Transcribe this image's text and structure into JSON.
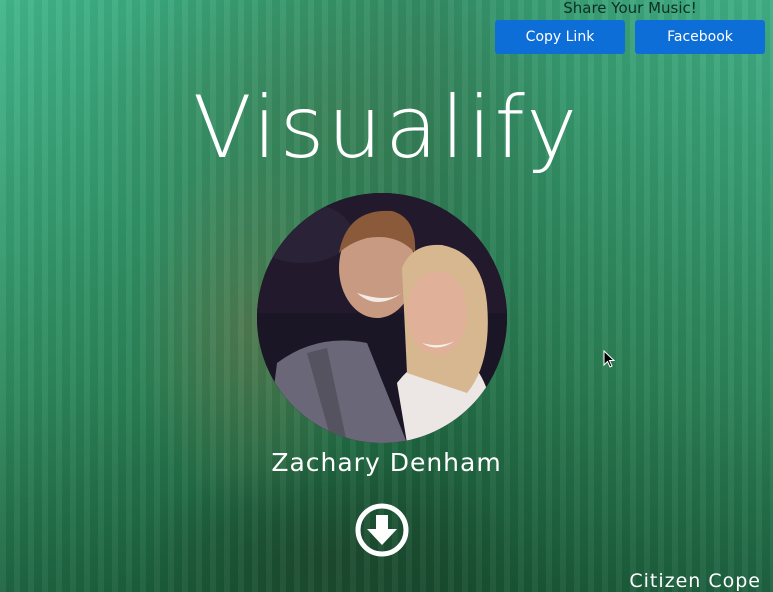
{
  "app": {
    "title": "Visualify"
  },
  "share": {
    "title": "Share Your Music!",
    "copy_link_label": "Copy Link",
    "facebook_label": "Facebook"
  },
  "profile": {
    "name": "Zachary Denham"
  },
  "track": {
    "artist": "Citizen Cope"
  },
  "icons": {
    "download": "arrow-down-circle-icon"
  },
  "colors": {
    "button": "#0e6ed8",
    "text": "#ffffff",
    "background": "#6fc7a8"
  }
}
